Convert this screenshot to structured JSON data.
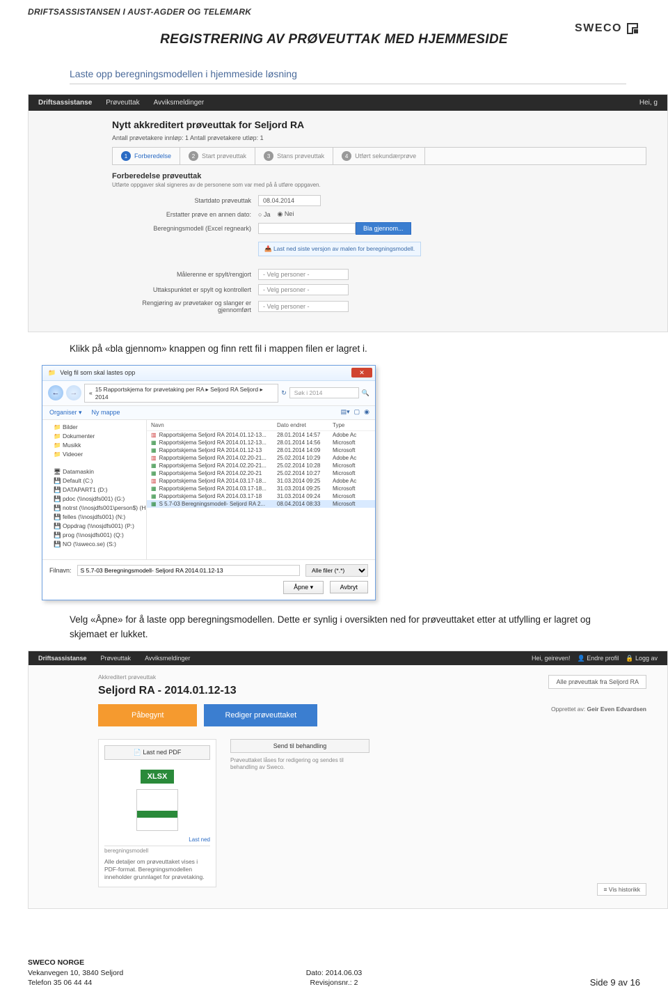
{
  "header": {
    "org": "DRIFTSASSISTANSEN I AUST-AGDER OG TELEMARK",
    "logo_text": "SWECO",
    "title": "REGISTRERING AV PRØVEUTTAK MED HJEMMESIDE"
  },
  "section1": {
    "heading": "Laste opp beregningsmodellen i hjemmeside løsning"
  },
  "app1": {
    "nav": {
      "brand": "Driftsassistanse",
      "item1": "Prøveuttak",
      "item2": "Avviksmeldinger",
      "user": "Hei, g"
    },
    "title": "Nytt akkreditert prøveuttak for Seljord RA",
    "counts": "Antall prøvetakere innløp: 1     Antall prøvetakere utløp: 1",
    "steps": {
      "s1": "Forberedelse",
      "s2": "Start prøveuttak",
      "s3": "Stans prøveuttak",
      "s4": "Utført sekundærprøve"
    },
    "form_heading": "Forberedelse prøveuttak",
    "form_note": "Utførte oppgaver skal signeres av de personene som var med på å utføre oppgaven.",
    "row_start_label": "Startdato prøveuttak",
    "row_start_val": "08.04.2014",
    "row_replace_label": "Erstatter prøve en annen dato:",
    "row_replace_yes": "Ja",
    "row_replace_no": "Nei",
    "row_model_label": "Beregningsmodell (Excel regneark)",
    "row_model_btn": "Bla gjennom...",
    "hint": "Last ned siste versjon av malen for beregningsmodell.",
    "row_m1": "Målerenne er spylt/rengjort",
    "row_m2": "Uttakspunktet er spylt og kontrollert",
    "row_m3": "Rengjøring av prøvetaker og slanger er gjennomført",
    "select_placeholder": "- Velg personer -"
  },
  "para1": "Klikk på «bla gjennom» knappen og finn rett fil i mappen filen er lagret i.",
  "dialog": {
    "title": "Velg fil som skal lastes opp",
    "crumb": "15 Rapportskjema for prøvetaking per RA ▸ Seljord RA Seljord ▸ 2014",
    "search_placeholder": "Søk i 2014",
    "organize": "Organiser ▾",
    "new_folder": "Ny mappe",
    "side": [
      "Bilder",
      "Dokumenter",
      "Musikk",
      "Videoer",
      "",
      "Datamaskin",
      "Default (C:)",
      "DATAPART1 (D:)",
      "pdoc (\\\\nosjdfs001) (G:)",
      "notrst (\\\\nosjdfs001\\person$) (H:)",
      "felles (\\\\nosjdfs001) (N:)",
      "Oppdrag (\\\\nosjdfs001) (P:)",
      "prog (\\\\nosjdfs001) (Q:)",
      "NO (\\\\sweco.se) (S:)"
    ],
    "columns": {
      "name": "Navn",
      "date": "Dato endret",
      "type": "Type"
    },
    "files": [
      {
        "icon": "pdf",
        "name": "Rapportskjema Seljord RA 2014.01.12-13...",
        "date": "28.01.2014 14:57",
        "type": "Adobe Ac"
      },
      {
        "icon": "xls",
        "name": "Rapportskjema Seljord RA 2014.01.12-13...",
        "date": "28.01.2014 14:56",
        "type": "Microsoft"
      },
      {
        "icon": "xls",
        "name": "Rapportskjema Seljord RA 2014.01.12-13",
        "date": "28.01.2014 14:09",
        "type": "Microsoft"
      },
      {
        "icon": "pdf",
        "name": "Rapportskjema Seljord RA 2014.02.20-21...",
        "date": "25.02.2014 10:29",
        "type": "Adobe Ac"
      },
      {
        "icon": "xls",
        "name": "Rapportskjema Seljord RA 2014.02.20-21...",
        "date": "25.02.2014 10:28",
        "type": "Microsoft"
      },
      {
        "icon": "xls",
        "name": "Rapportskjema Seljord RA 2014.02.20-21",
        "date": "25.02.2014 10:27",
        "type": "Microsoft"
      },
      {
        "icon": "pdf",
        "name": "Rapportskjema Seljord RA 2014.03.17-18...",
        "date": "31.03.2014 09:25",
        "type": "Adobe Ac"
      },
      {
        "icon": "xls",
        "name": "Rapportskjema Seljord RA 2014.03.17-18...",
        "date": "31.03.2014 09:25",
        "type": "Microsoft"
      },
      {
        "icon": "xls",
        "name": "Rapportskjema Seljord RA 2014.03.17-18",
        "date": "31.03.2014 09:24",
        "type": "Microsoft"
      },
      {
        "icon": "xls",
        "name": "S 5.7-03 Beregningsmodell- Seljord RA 2...",
        "date": "08.04.2014 08:33",
        "type": "Microsoft",
        "selected": true
      }
    ],
    "filename_label": "Filnavn:",
    "filename_value": "S 5.7-03 Beregningsmodell- Seljord RA 2014.01.12-13",
    "filter": "Alle filer (*.*)",
    "open": "Åpne",
    "cancel": "Avbryt"
  },
  "para2": "Velg «Åpne» for å laste opp beregningsmodellen. Dette er synlig i oversikten ned for prøveuttaket etter at utfylling er lagret og skjemaet er lukket.",
  "app3": {
    "nav": {
      "brand": "Driftsassistanse",
      "item1": "Prøveuttak",
      "item2": "Avviksmeldinger",
      "greet": "Hei, geireven!",
      "edit": "Endre profil",
      "logout": "Logg av"
    },
    "crumb": "Akkreditert prøveuttak",
    "title": "Seljord RA - 2014.01.12-13",
    "all_btn": "Alle prøveuttak fra Seljord RA",
    "orange": "Påbegynt",
    "blue": "Rediger prøveuttaket",
    "created_label": "Opprettet av:",
    "created_name": "Geir Even Edvardsen",
    "pdf_btn": "Last ned PDF",
    "pdf_caption": "Alle detaljer om prøveuttaket vises i PDF-format. Beregningsmodellen inneholder grunnlaget for prøvetaking.",
    "xlsx_label": "XLSX",
    "xlsx_caption": "Last ned",
    "xlsx_name": "beregningsmodell",
    "send_btn": "Send til behandling",
    "send_caption": "Prøveuttaket låses for redigering og sendes til behandling av Sweco.",
    "history": "Vis historikk"
  },
  "footer": {
    "company": "SWECO NORGE",
    "addr": "Vekanvegen 10, 3840 Seljord",
    "phone": "Telefon 35 06 44 44",
    "date_label": "Dato: 2014.06.03",
    "rev_label": "Revisjonsnr.: 2",
    "page": "Side 9 av 16"
  }
}
